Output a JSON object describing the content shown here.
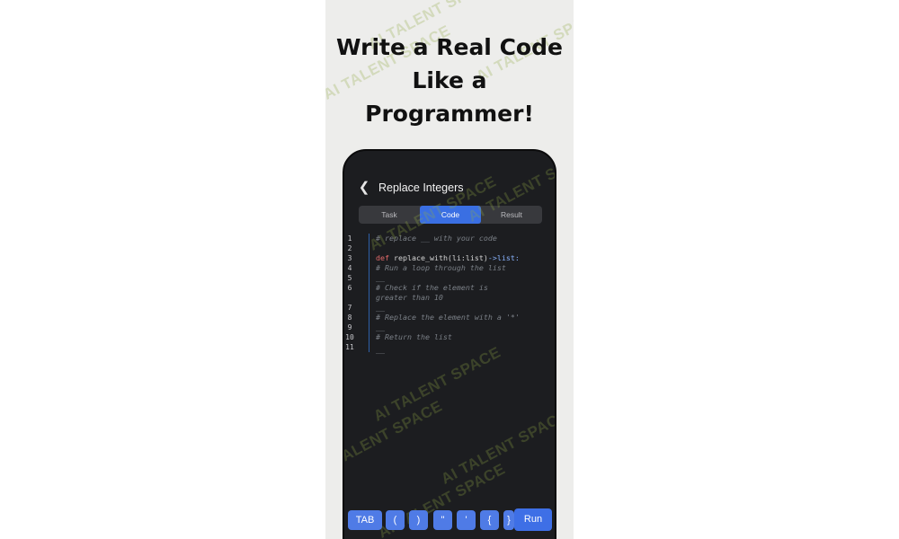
{
  "headline": [
    "Write a Real Code",
    "Like a",
    "Programmer!"
  ],
  "app": {
    "back_icon": "chevron-left-icon",
    "title": "Replace Integers",
    "tabs": [
      {
        "label": "Task",
        "active": false
      },
      {
        "label": "Code",
        "active": true
      },
      {
        "label": "Result",
        "active": false
      }
    ]
  },
  "editor": {
    "line_numbers": [
      "1",
      "2",
      "3",
      "4",
      "5",
      "6",
      "7",
      "8",
      "9",
      "10",
      "11"
    ],
    "code_lines": [
      {
        "text": "# replace __ with your code"
      },
      {
        "text": ""
      },
      {
        "keyword": "def",
        "name": " replace_with(li:list)",
        "arrow": "->list:"
      },
      {
        "text": "  # Run a loop through the list"
      },
      {
        "text": "  __"
      },
      {
        "text": "  # Check if the element is"
      },
      {
        "text": "greater than 10"
      },
      {
        "text": "  __"
      },
      {
        "text": "  # Replace the element with a '*'"
      },
      {
        "text": "  __"
      },
      {
        "text": "  # Return the list"
      },
      {
        "text": "  __"
      }
    ]
  },
  "keyboard": {
    "keys": [
      "TAB",
      "(",
      ")",
      "\"",
      "'",
      "{",
      "}"
    ],
    "run_label": "Run"
  },
  "watermark": "AI TALENT SPACE",
  "colors": {
    "accent": "#3a6fe3",
    "phone_bg": "#1c1d20"
  }
}
